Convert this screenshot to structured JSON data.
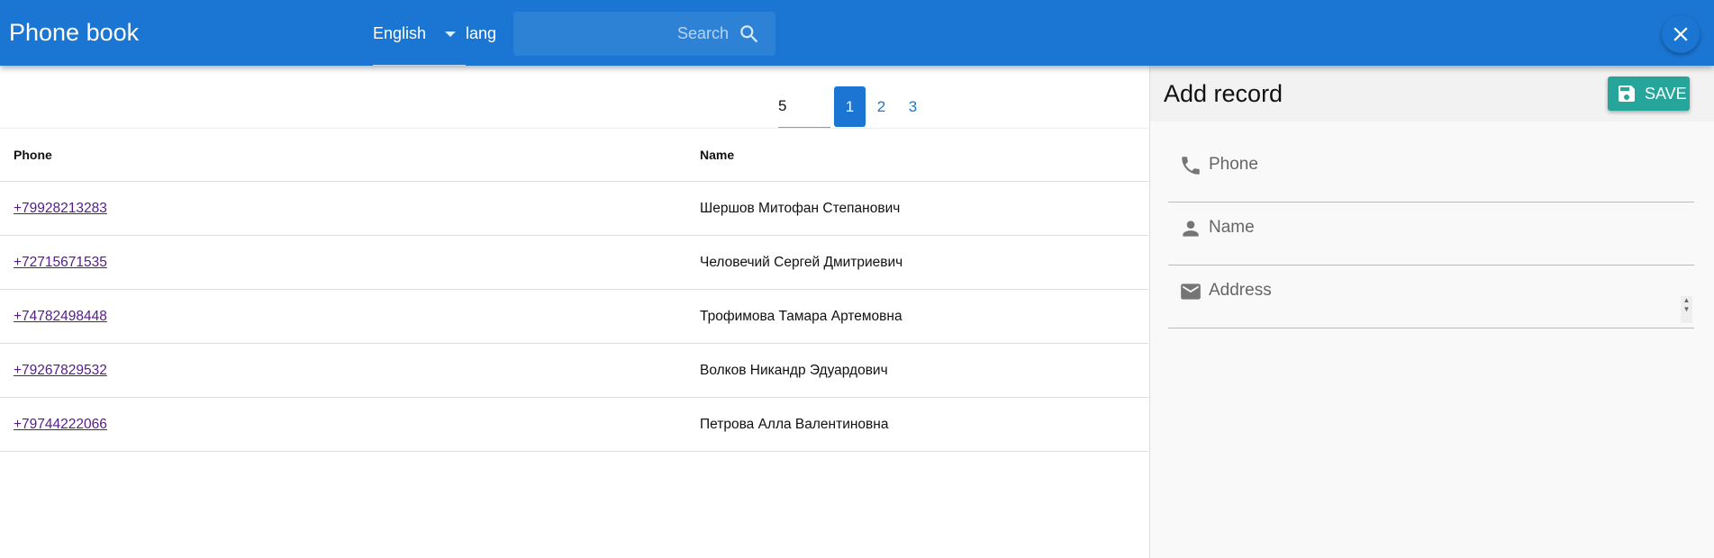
{
  "header": {
    "title": "Phone book",
    "language": "English",
    "language_label": "lang",
    "search_placeholder": "Search"
  },
  "pagination": {
    "page_size": "5",
    "pages": [
      "1",
      "2",
      "3"
    ],
    "current": "1"
  },
  "table": {
    "columns": [
      "Phone",
      "Name"
    ],
    "rows": [
      {
        "phone": "+79928213283",
        "name": "Шершов Митофан Степанович"
      },
      {
        "phone": "+72715671535",
        "name": "Человечий Сергей Дмитриевич"
      },
      {
        "phone": "+74782498448",
        "name": "Трофимова Тамара Артемовна"
      },
      {
        "phone": "+79267829532",
        "name": "Волков Никандр Эдуардович"
      },
      {
        "phone": "+79744222066",
        "name": "Петрова Алла Валентиновна"
      }
    ]
  },
  "panel": {
    "title": "Add record",
    "save_label": "SAVE",
    "fields": {
      "phone": "Phone",
      "name": "Name",
      "address": "Address"
    }
  },
  "colors": {
    "primary": "#1b76d3",
    "accent": "#26a69a"
  }
}
